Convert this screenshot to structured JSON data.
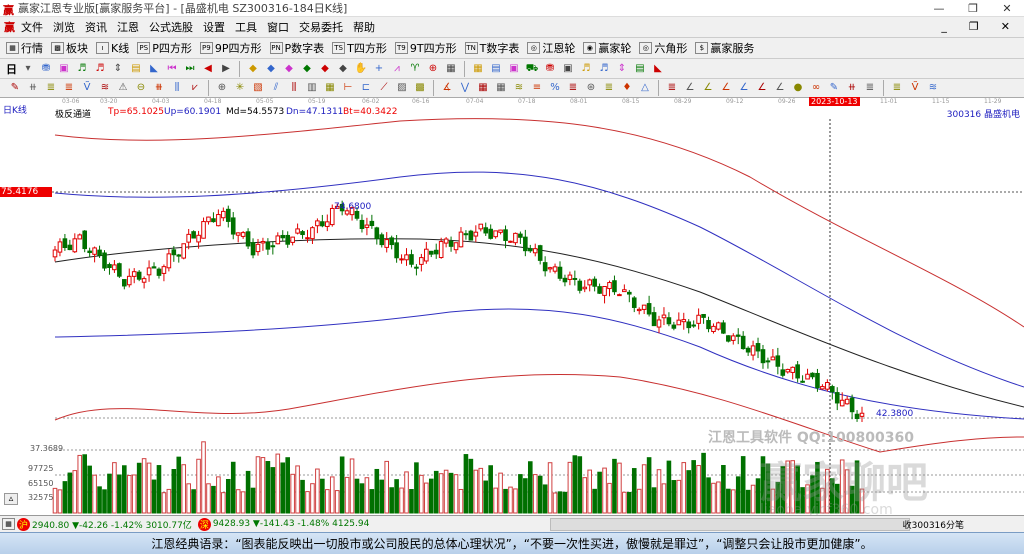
{
  "window": {
    "title": "赢家江恩专业版[赢家服务平台] - [晶盛机电  SZ300316-184日K线]",
    "min": "—",
    "max": "❐",
    "close": "✕"
  },
  "menu": [
    "文件",
    "浏览",
    "资讯",
    "江恩",
    "公式选股",
    "设置",
    "工具",
    "窗口",
    "交易委托",
    "帮助"
  ],
  "menu_logo": "赢",
  "mdi": [
    "_",
    "❐",
    "✕"
  ],
  "toolbar1": [
    {
      "icon": "grid-icon",
      "label": "行情",
      "glyph": "▦"
    },
    {
      "icon": "blocks-icon",
      "label": "板块",
      "glyph": "▩"
    },
    {
      "icon": "kline-icon",
      "label": "K线",
      "glyph": "ı"
    },
    {
      "icon": "p-square-icon",
      "label": "P四方形",
      "glyph": "PS"
    },
    {
      "icon": "9p-square-icon",
      "label": "9P四方形",
      "glyph": "P9"
    },
    {
      "icon": "p-table-icon",
      "label": "P数字表",
      "glyph": "PN"
    },
    {
      "icon": "t-square-icon",
      "label": "T四方形",
      "glyph": "TS"
    },
    {
      "icon": "9t-square-icon",
      "label": "9T四方形",
      "glyph": "T9"
    },
    {
      "icon": "t-table-icon",
      "label": "T数字表",
      "glyph": "TN"
    },
    {
      "icon": "gann-wheel-icon",
      "label": "江恩轮",
      "glyph": "◎"
    },
    {
      "icon": "winner-wheel-icon",
      "label": "赢家轮",
      "glyph": "◉"
    },
    {
      "icon": "hexagon-icon",
      "label": "六角形",
      "glyph": "◎"
    },
    {
      "icon": "dollar-icon",
      "label": "赢家服务",
      "glyph": "$"
    }
  ],
  "period": "日",
  "chart": {
    "period_label": "日K线",
    "indicator": "极反通道",
    "tp": "Tp=65.1025",
    "up": "Up=60.1901",
    "md": "Md=54.5573",
    "dn": "Dn=47.1311",
    "bt": "Bt=40.3422",
    "stock": "300316  晶盛机电",
    "price_marker": "75.4176",
    "high_label": "74.6800",
    "low_label": "42.3800",
    "bottom_price": "37.3689",
    "cursor_date": "2023-10-13",
    "dates": [
      "03-06",
      "03-20",
      "04-03",
      "04-18",
      "05-05",
      "05-19",
      "06-02",
      "06-16",
      "07-04",
      "07-18",
      "08-01",
      "08-15",
      "08-29",
      "09-12",
      "09-26",
      "11-01",
      "11-15",
      "11-29"
    ],
    "vol_ticks": [
      "97725",
      "65150",
      "32575"
    ],
    "watermark1": "江恩工具软件  QQ:100800360",
    "watermark2": "赢家聊吧",
    "watermark3": "liaoba.yjcf360.com"
  },
  "chart_data": {
    "type": "candlestick",
    "price_range": [
      37.3689,
      78
    ],
    "path": [
      [
        0,
        66.9
      ],
      [
        5,
        68.4
      ],
      [
        14,
        62.5
      ],
      [
        21,
        64
      ],
      [
        29,
        69.8
      ],
      [
        33,
        72.5
      ],
      [
        40,
        67
      ],
      [
        46,
        68.4
      ],
      [
        52,
        69.8
      ],
      [
        58,
        73.5
      ],
      [
        66,
        68.4
      ],
      [
        72,
        64.7
      ],
      [
        78,
        67.6
      ],
      [
        86,
        69.8
      ],
      [
        94,
        68.4
      ],
      [
        100,
        64
      ],
      [
        106,
        61.8
      ],
      [
        114,
        61.1
      ],
      [
        121,
        56.7
      ],
      [
        127,
        56
      ],
      [
        131,
        56.7
      ],
      [
        139,
        53
      ],
      [
        147,
        49.4
      ],
      [
        155,
        47.2
      ],
      [
        161,
        43.5
      ],
      [
        163,
        42.4
      ]
    ],
    "vol_max": 130300
  },
  "status": {
    "sh": "2940.80 ▼-42.26 -1.42% 3010.77亿",
    "sz": "9428.93 ▼-141.43 -1.48% 4125.94",
    "right": "收300316分笔",
    "sh_badge": "沪",
    "sz_badge": "深"
  },
  "quote": "江恩经典语录：“图表能反映出一切股市或公司股民的总体心理状况”，“不要一次性买进，傲慢就是罪过”，“调整只会让股市更加健康”。",
  "colors": {
    "up": "#e00000",
    "down": "#007000",
    "blue": "#2020c0"
  }
}
